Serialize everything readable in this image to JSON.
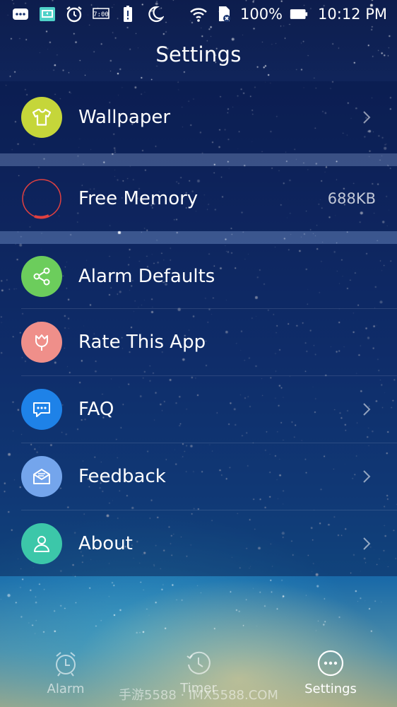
{
  "status_bar": {
    "battery": "100%",
    "time": "10:12 PM",
    "icons": [
      "chat-icon",
      "cast-icon",
      "alarm-clock-icon",
      "clock-widget-icon",
      "battery-alert-icon",
      "moon-icon",
      "wifi-icon",
      "sd-card-icon",
      "battery-icon"
    ]
  },
  "header": {
    "title": "Settings"
  },
  "settings": {
    "wallpaper": {
      "label": "Wallpaper",
      "icon": "tshirt-icon",
      "color": "#c5d63a"
    },
    "free_memory": {
      "label": "Free Memory",
      "value": "688KB",
      "icon": "memory-ring-icon",
      "color": "#e04040"
    },
    "alarm_defaults": {
      "label": "Alarm Defaults",
      "icon": "share-icon",
      "color": "#6ccd5c"
    },
    "rate_app": {
      "label": "Rate This App",
      "icon": "tulip-icon",
      "color": "#ef8f8a"
    },
    "faq": {
      "label": "FAQ",
      "icon": "chat-bubble-icon",
      "color": "#1e82e8"
    },
    "feedback": {
      "label": "Feedback",
      "icon": "mail-icon",
      "color": "#74a5ec"
    },
    "about": {
      "label": "About",
      "icon": "person-icon",
      "color": "#3cc7a9"
    }
  },
  "nav": {
    "alarm": {
      "label": "Alarm",
      "icon": "alarm-icon"
    },
    "timer": {
      "label": "Timer",
      "icon": "history-clock-icon"
    },
    "settings": {
      "label": "Settings",
      "icon": "more-dots-icon"
    }
  },
  "watermark": "手游5588 · IMX5588.COM"
}
